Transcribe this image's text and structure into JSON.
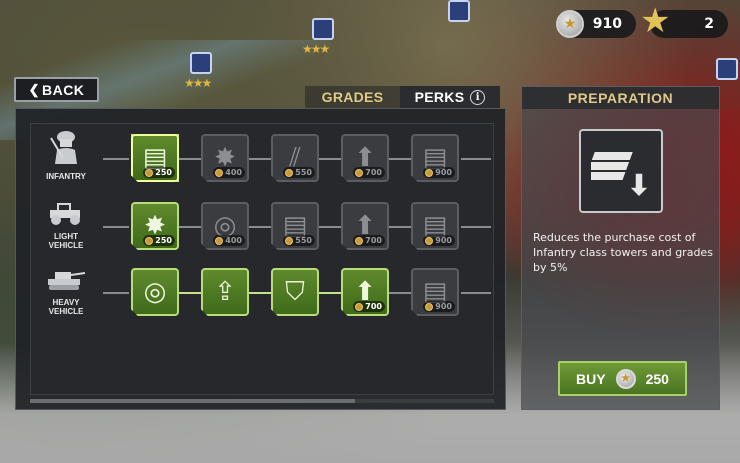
{
  "currency": {
    "coins": "910",
    "stars": "2"
  },
  "back": {
    "label": "BACK"
  },
  "tabs": {
    "grades": "GRADES",
    "perks": "PERKS",
    "info": "i"
  },
  "rows": [
    {
      "label": "INFANTRY",
      "unit_icon": "soldier-icon"
    },
    {
      "label_line1": "LIGHT",
      "label_line2": "VEHICLE",
      "unit_icon": "jeep-icon"
    },
    {
      "label_line1": "HEAVY",
      "label_line2": "VEHICLE",
      "unit_icon": "tank-icon"
    }
  ],
  "perks": {
    "row1": [
      {
        "icon": "money-down-icon",
        "price": "250",
        "owned": true,
        "selected": true
      },
      {
        "icon": "explosion-icon",
        "price": "400",
        "owned": false
      },
      {
        "icon": "claw-icon",
        "price": "550",
        "owned": false
      },
      {
        "icon": "fist-up-icon",
        "price": "700",
        "owned": false
      },
      {
        "icon": "money-up-icon",
        "price": "900",
        "owned": false
      }
    ],
    "row2": [
      {
        "icon": "explosion-icon",
        "price": "250",
        "owned": true
      },
      {
        "icon": "shell-icon",
        "price": "400",
        "owned": false
      },
      {
        "icon": "money-down-icon",
        "price": "550",
        "owned": false
      },
      {
        "icon": "fist-up-icon",
        "price": "700",
        "owned": false
      },
      {
        "icon": "money-up-icon",
        "price": "900",
        "owned": false
      }
    ],
    "row3": [
      {
        "icon": "shell-icon",
        "price": "",
        "owned": true
      },
      {
        "icon": "area-up-icon",
        "price": "",
        "owned": true
      },
      {
        "icon": "shield-icon",
        "price": "",
        "owned": true
      },
      {
        "icon": "fist-up-icon",
        "price": "700",
        "owned": true
      },
      {
        "icon": "money-up-icon",
        "price": "900",
        "owned": false
      }
    ]
  },
  "preparation": {
    "title": "PREPARATION",
    "description": "Reduces the purchase cost of Infantry class towers and grades by 5%",
    "buy_label": "BUY",
    "buy_price": "250"
  }
}
